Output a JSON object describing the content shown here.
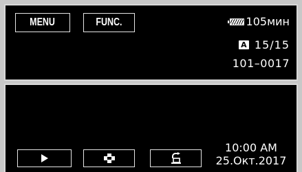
{
  "top_bar": {
    "menu_label": "MENU",
    "func_label": "FUNC."
  },
  "status": {
    "battery_icon": "battery-icon",
    "battery_remaining": "105мин",
    "mode_badge": "A",
    "clip_counter": "15/15",
    "file_number": "101–0017"
  },
  "bottom_bar": {
    "play_icon": "play-icon",
    "index_icon": "index-icon",
    "return_icon": "return-icon",
    "time": "10:00 AM",
    "date": "25.Окт.2017"
  },
  "colors": {
    "panel_background": "#000000",
    "frame": "#c8c8c8",
    "text": "#ffffff",
    "button_border": "#e6e6e6"
  }
}
